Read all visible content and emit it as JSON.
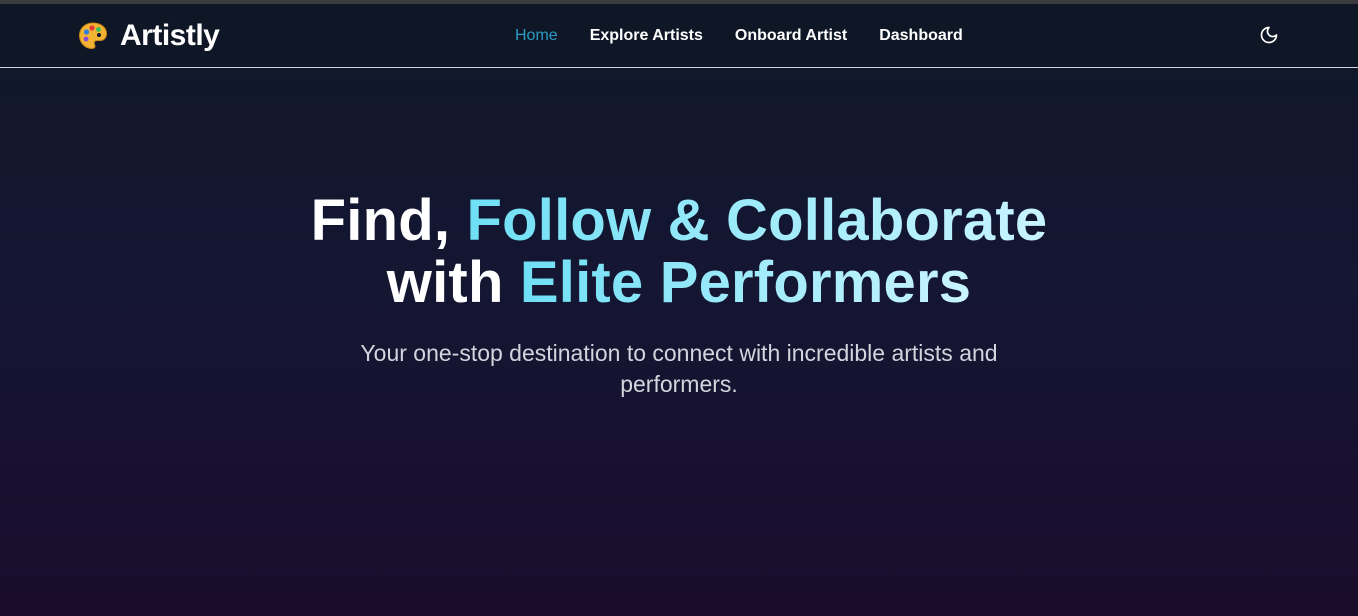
{
  "brand": {
    "name": "Artistly",
    "logo_icon": "artist-palette-icon"
  },
  "nav": {
    "items": [
      {
        "label": "Home",
        "active": true
      },
      {
        "label": "Explore Artists",
        "active": false
      },
      {
        "label": "Onboard Artist",
        "active": false
      },
      {
        "label": "Dashboard",
        "active": false
      }
    ],
    "theme_toggle_icon": "moon-icon"
  },
  "hero": {
    "title_part1": "Find, ",
    "title_part2": "Follow & Collaborate",
    "title_part3": "with ",
    "title_part4": "Elite Performers",
    "subtitle": "Your one-stop destination to connect with incredible artists and performers."
  },
  "colors": {
    "background_top": "#101828",
    "background_bottom": "#1b0c2c",
    "nav_active": "#2b9cc4",
    "hero_accent": "#8ee6f7",
    "subtitle": "#d2d5de"
  }
}
